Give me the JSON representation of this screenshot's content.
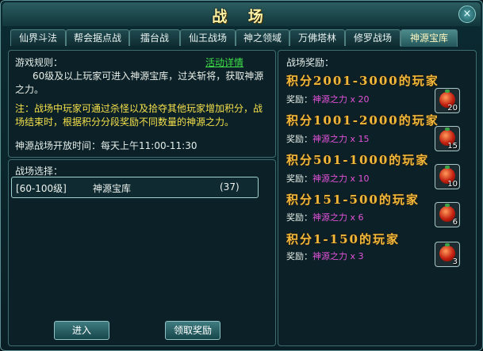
{
  "window": {
    "title": "战 场",
    "close": "×"
  },
  "tabs": [
    {
      "label": "仙界斗法"
    },
    {
      "label": "帮会据点战"
    },
    {
      "label": "擂台战"
    },
    {
      "label": "仙王战场"
    },
    {
      "label": "神之领域"
    },
    {
      "label": "万佛塔林"
    },
    {
      "label": "修罗战场"
    },
    {
      "label": "神源宝库"
    }
  ],
  "rules": {
    "heading": "游戏规则：",
    "detail_link": "活动详情",
    "text1": "60级及以上玩家可进入神源宝库，过关斩将，获取神源之力。",
    "note": "注：战场中玩家可通过杀怪以及拾夺其他玩家增加积分，战场结束时，根据积分分段奖励不同数量的神源之力。",
    "open_time": "神源战场开放时间：每天上午11:00-11:30"
  },
  "selection": {
    "heading": "战场选择：",
    "rows": [
      {
        "level": "[60-100级]",
        "name": "神源宝库",
        "count": "(37)"
      }
    ]
  },
  "buttons": {
    "enter": "进入",
    "claim": "领取奖励"
  },
  "rewards": {
    "heading": "战场奖励：",
    "tiers": [
      {
        "title": "积分2001-3000的玩家",
        "label": "奖励：",
        "item": "神源之力 x 20",
        "qty": "20"
      },
      {
        "title": "积分1001-2000的玩家",
        "label": "奖励：",
        "item": "神源之力 x 15",
        "qty": "15"
      },
      {
        "title": "积分501-1000的玩家",
        "label": "奖励：",
        "item": "神源之力 x 10",
        "qty": "10"
      },
      {
        "title": "积分151-500的玩家",
        "label": "奖励：",
        "item": "神源之力 x 6",
        "qty": "6"
      },
      {
        "title": "积分1-150的玩家",
        "label": "奖励：",
        "item": "神源之力 x 3",
        "qty": "3"
      }
    ]
  },
  "colors": {
    "tier_title": "#f1b83a",
    "reward_value": "#e352d9",
    "link": "#3fe34a",
    "note": "#f4e04a"
  },
  "icons": {
    "reward_item": "red-orb-icon",
    "close": "close-icon"
  }
}
